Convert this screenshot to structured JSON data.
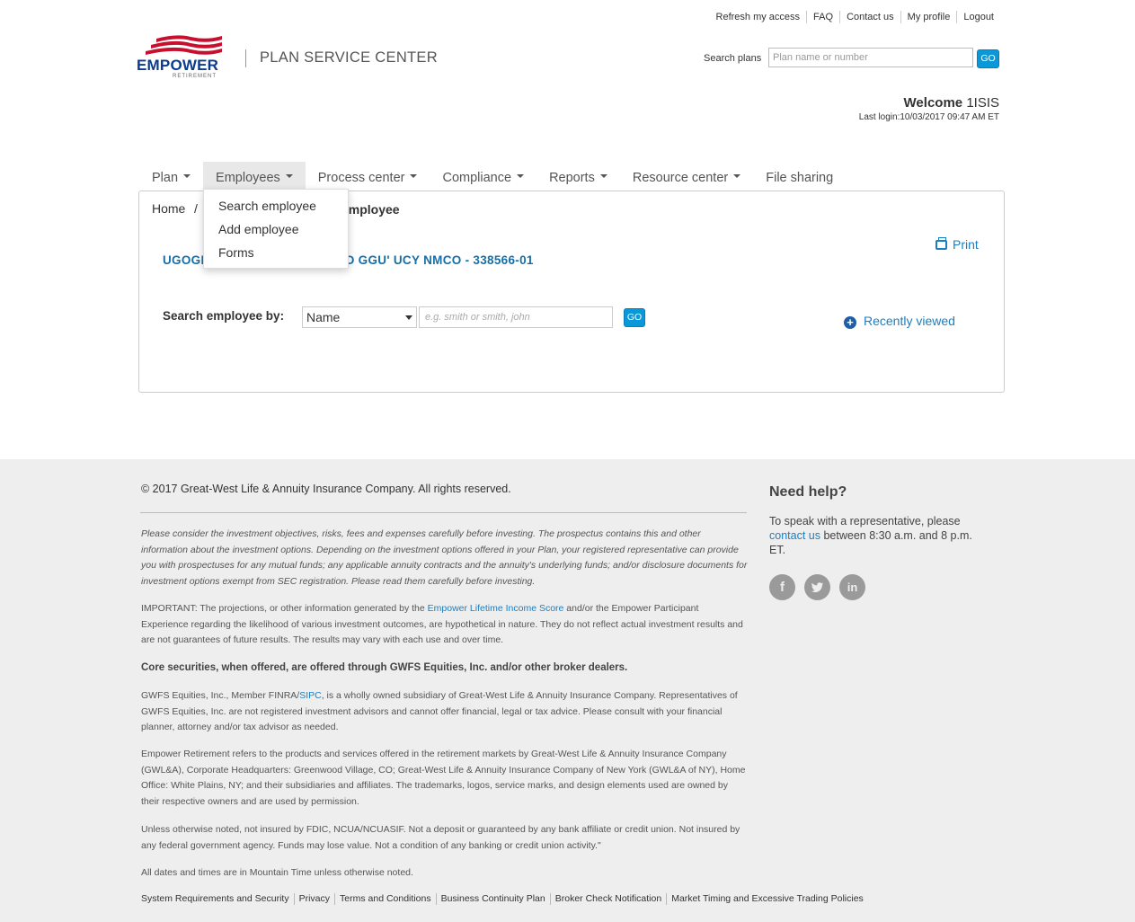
{
  "header": {
    "util_links": [
      "Refresh my access",
      "FAQ",
      "Contact us",
      "My profile",
      "Logout"
    ],
    "logo_text": "EMPOWER",
    "logo_sub": "RETIREMENT",
    "app_title": "PLAN SERVICE CENTER",
    "search_label": "Search plans",
    "search_placeholder": "Plan name or number",
    "go_label": "GO",
    "welcome_label": "Welcome",
    "welcome_user": "1ISIS",
    "last_login": "Last login:10/03/2017 09:47 AM ET"
  },
  "nav": {
    "items": [
      "Plan",
      "Employees",
      "Process center",
      "Compliance",
      "Reports",
      "Resource center",
      "File sharing"
    ],
    "active": "Employees",
    "dropdown": [
      "Search employee",
      "Add employee",
      "Forms"
    ]
  },
  "main": {
    "breadcrumb_home": "Home",
    "breadcrumb_sep": "/",
    "breadcrumb_current": "employee",
    "plan_name_suffix": "SO GGU' UCY NMCO - 338566-01",
    "plan_name_prefix": "UGOGI",
    "print_label": "Print",
    "search_by_label": "Search employee by:",
    "search_by_value": "Name",
    "search_placeholder": "e.g. smith or smith, john",
    "go_label": "GO",
    "recently_viewed": "Recently viewed"
  },
  "footer": {
    "copyright": "© 2017 Great-West Life & Annuity Insurance Company. All rights reserved.",
    "para1": "Please consider the investment objectives, risks, fees and expenses carefully before investing. The prospectus contains this and other information about the investment options. Depending on the investment options offered in your Plan, your registered representative can provide you with prospectuses for any mutual funds; any applicable annuity contracts and the annuity's underlying funds; and/or disclosure documents for investment options exempt from SEC registration. Please read them carefully before investing.",
    "para2_a": "IMPORTANT: The projections, or other information generated by the ",
    "para2_link": "Empower Lifetime Income Score",
    "para2_b": " and/or the Empower Participant Experience regarding the likelihood of various investment outcomes, are hypothetical in nature. They do not reflect actual investment results and are not guarantees of future results. The results may vary with each use and over time.",
    "para3": "Core securities, when offered, are offered through GWFS Equities, Inc. and/or other broker dealers.",
    "para4_a": "GWFS Equities, Inc., Member FINRA/",
    "para4_link": "SIPC",
    "para4_b": ", is a wholly owned subsidiary of Great-West Life & Annuity Insurance Company. Representatives of GWFS Equities, Inc. are not registered investment advisors and cannot offer financial, legal or tax advice. Please consult with your financial planner, attorney and/or tax advisor as needed.",
    "para5": "Empower Retirement refers to the products and services offered in the retirement markets by Great-West Life & Annuity Insurance Company (GWL&A), Corporate Headquarters: Greenwood Village, CO; Great-West Life & Annuity Insurance Company of New York (GWL&A of NY), Home Office: White Plains, NY; and their subsidiaries and affiliates. The trademarks, logos, service marks, and design elements used are owned by their respective owners and are used by permission.",
    "para6": "Unless otherwise noted, not insured by FDIC, NCUA/NCUASIF. Not a deposit or guaranteed by any bank affiliate or credit union. Not insured by any federal government agency. Funds may lose value. Not a condition of any banking or credit union activity.\"",
    "para7": "All dates and times are in Mountain Time unless otherwise noted.",
    "help_title": "Need help?",
    "help_text_a": "To speak with a representative, please",
    "help_link": "contact us",
    "help_text_b": " between 8:30 a.m. and 8 p.m. ET.",
    "social_icons": [
      "facebook-icon",
      "twitter-icon",
      "linkedin-icon"
    ],
    "links": [
      "System Requirements and Security",
      "Privacy",
      "Terms and Conditions",
      "Business Continuity Plan",
      "Broker Check Notification",
      "Market Timing and Excessive Trading Policies"
    ]
  },
  "colors": {
    "accent": "#0a98d8",
    "link": "#1a7fc1",
    "brand_blue": "#0b3b8c",
    "brand_red": "#c8102e"
  }
}
